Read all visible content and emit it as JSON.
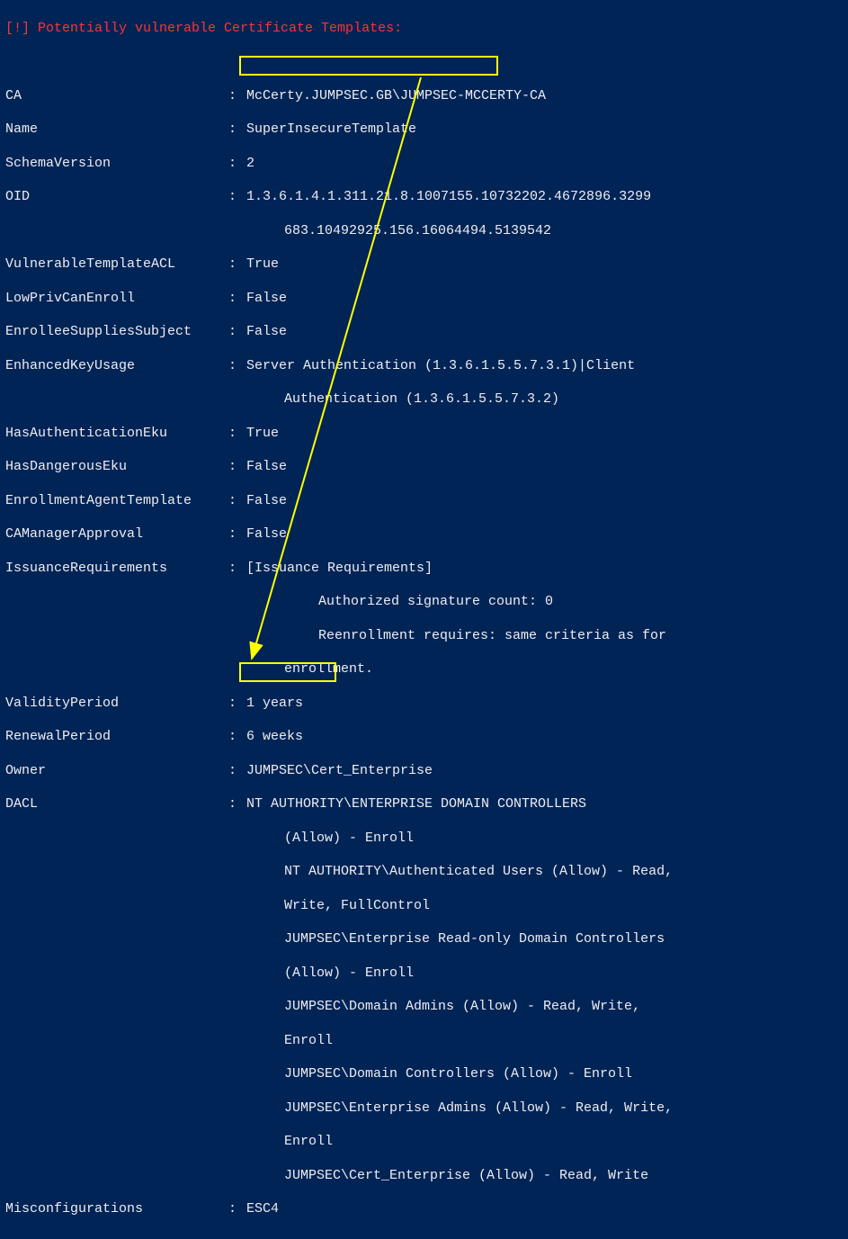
{
  "header": "[!] Potentially vulnerable Certificate Templates:",
  "rows": {
    "ca_k": "CA",
    "ca_v": "McCerty.JUMPSEC.GB\\JUMPSEC-MCCERTY-CA",
    "name_k": "Name",
    "name_v": "SuperInsecureTemplate",
    "schema_k": "SchemaVersion",
    "schema_v": "2",
    "oid_k": "OID",
    "oid_v1": "1.3.6.1.4.1.311.21.8.1007155.10732202.4672896.3299",
    "oid_v2": "683.10492925.156.16064494.5139542",
    "vtacl_k": "VulnerableTemplateACL",
    "vtacl_v": "True",
    "lowpriv_k": "LowPrivCanEnroll",
    "lowpriv_v": "False",
    "ess_k": "EnrolleeSuppliesSubject",
    "ess_v": "False",
    "eku_k": "EnhancedKeyUsage",
    "eku_v1": "Server Authentication (1.3.6.1.5.5.7.3.1)|Client",
    "eku_v2": "Authentication (1.3.6.1.5.5.7.3.2)",
    "hasauth_k": "HasAuthenticationEku",
    "hasauth_v": "True",
    "hasdang_k": "HasDangerousEku",
    "hasdang_v": "False",
    "eat_k": "EnrollmentAgentTemplate",
    "eat_v": "False",
    "camgr_k": "CAManagerApproval",
    "camgr_v": "False",
    "ireq_k": "IssuanceRequirements",
    "ireq_v1": "[Issuance Requirements]",
    "ireq_v2": "Authorized signature count: 0",
    "ireq_v3": "Reenrollment requires: same criteria as for",
    "ireq_v4": "enrollment.",
    "valid_k": "ValidityPeriod",
    "valid_v": "1 years",
    "renew_k": "RenewalPeriod",
    "renew_v": "6 weeks",
    "owner_k": "Owner",
    "owner_v": "JUMPSEC\\Cert_Enterprise",
    "dacl_k": "DACL",
    "dacl_v1": "NT AUTHORITY\\ENTERPRISE DOMAIN CONTROLLERS",
    "dacl_v2": "(Allow) - Enroll",
    "dacl_v3": "NT AUTHORITY\\Authenticated Users (Allow) - Read,",
    "dacl_v4": "Write, FullControl",
    "dacl_v5": "JUMPSEC\\Enterprise Read-only Domain Controllers",
    "dacl_v6": "(Allow) - Enroll",
    "dacl_v7": "JUMPSEC\\Domain Admins (Allow) - Read, Write,",
    "dacl_v8": "Enroll",
    "dacl_v9": "JUMPSEC\\Domain Controllers (Allow) - Enroll",
    "dacl_v10": "JUMPSEC\\Enterprise Admins (Allow) - Read, Write,",
    "dacl_v11": "Enroll",
    "dacl_v12": "JUMPSEC\\Cert_Enterprise (Allow) - Read, Write",
    "misc_k": "Misconfigurations",
    "misc_v": "ESC4"
  }
}
